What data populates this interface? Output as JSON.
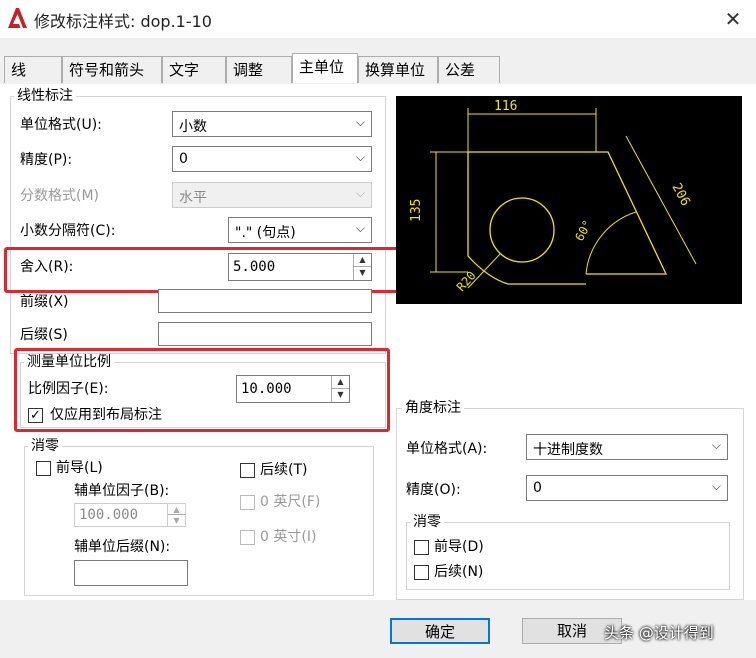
{
  "window": {
    "title": "修改标注样式: dop.1-10",
    "close_glyph": "✕"
  },
  "tabs": [
    {
      "label": "线"
    },
    {
      "label": "符号和箭头"
    },
    {
      "label": "文字"
    },
    {
      "label": "调整"
    },
    {
      "label": "主单位",
      "active": true
    },
    {
      "label": "换算单位"
    },
    {
      "label": "公差"
    }
  ],
  "linear": {
    "group_title": "线性标注",
    "unit_format": {
      "label": "单位格式(U):",
      "value": "小数"
    },
    "precision": {
      "label": "精度(P):",
      "value": "0"
    },
    "fraction_format": {
      "label": "分数格式(M)",
      "value": "水平"
    },
    "decimal_separator": {
      "label": "小数分隔符(C):",
      "value": "\".\" (句点)"
    },
    "round_off": {
      "label": "舍入(R):",
      "value": "5.000"
    },
    "prefix": {
      "label": "前缀(X)",
      "value": ""
    },
    "suffix": {
      "label": "后缀(S)",
      "value": ""
    }
  },
  "scale": {
    "group_title": "测量单位比例",
    "factor": {
      "label": "比例因子(E):",
      "value": "10.000"
    },
    "layout_only": {
      "label": "仅应用到布局标注",
      "checked": true,
      "check_glyph": "✓"
    }
  },
  "zero_suppression": {
    "group_title": "消零",
    "leading": {
      "label": "前导(L)",
      "checked": false
    },
    "trailing": {
      "label": "后续(T)",
      "checked": false
    },
    "sub_unit_factor": {
      "label": "辅单位因子(B):",
      "value": "100.000"
    },
    "sub_unit_suffix": {
      "label": "辅单位后缀(N):",
      "value": ""
    },
    "feet": {
      "label": "0 英尺(F)",
      "checked": false
    },
    "inches": {
      "label": "0 英寸(I)",
      "checked": false
    }
  },
  "angular": {
    "group_title": "角度标注",
    "unit_format": {
      "label": "单位格式(A):",
      "value": "十进制度数"
    },
    "precision": {
      "label": "精度(O):",
      "value": "0"
    },
    "zero_title": "消零",
    "leading": {
      "label": "前导(D)",
      "checked": false
    },
    "trailing": {
      "label": "后续(N)",
      "checked": false
    }
  },
  "preview": {
    "dim_top": "116",
    "dim_left": "135",
    "dim_right": "206",
    "dim_angle": "60°",
    "dim_radius": "R20"
  },
  "buttons": {
    "ok": "确定",
    "cancel": "取消"
  },
  "watermark": "头条 @设计得到",
  "colors": {
    "highlight": "#e0262e",
    "preview_line": "#f2e500",
    "app_icon": "#c8202a"
  },
  "icons": {
    "app": "autocad-a-icon",
    "dropdown": "chevron-down-icon",
    "spin": "spin-arrows-icon"
  }
}
